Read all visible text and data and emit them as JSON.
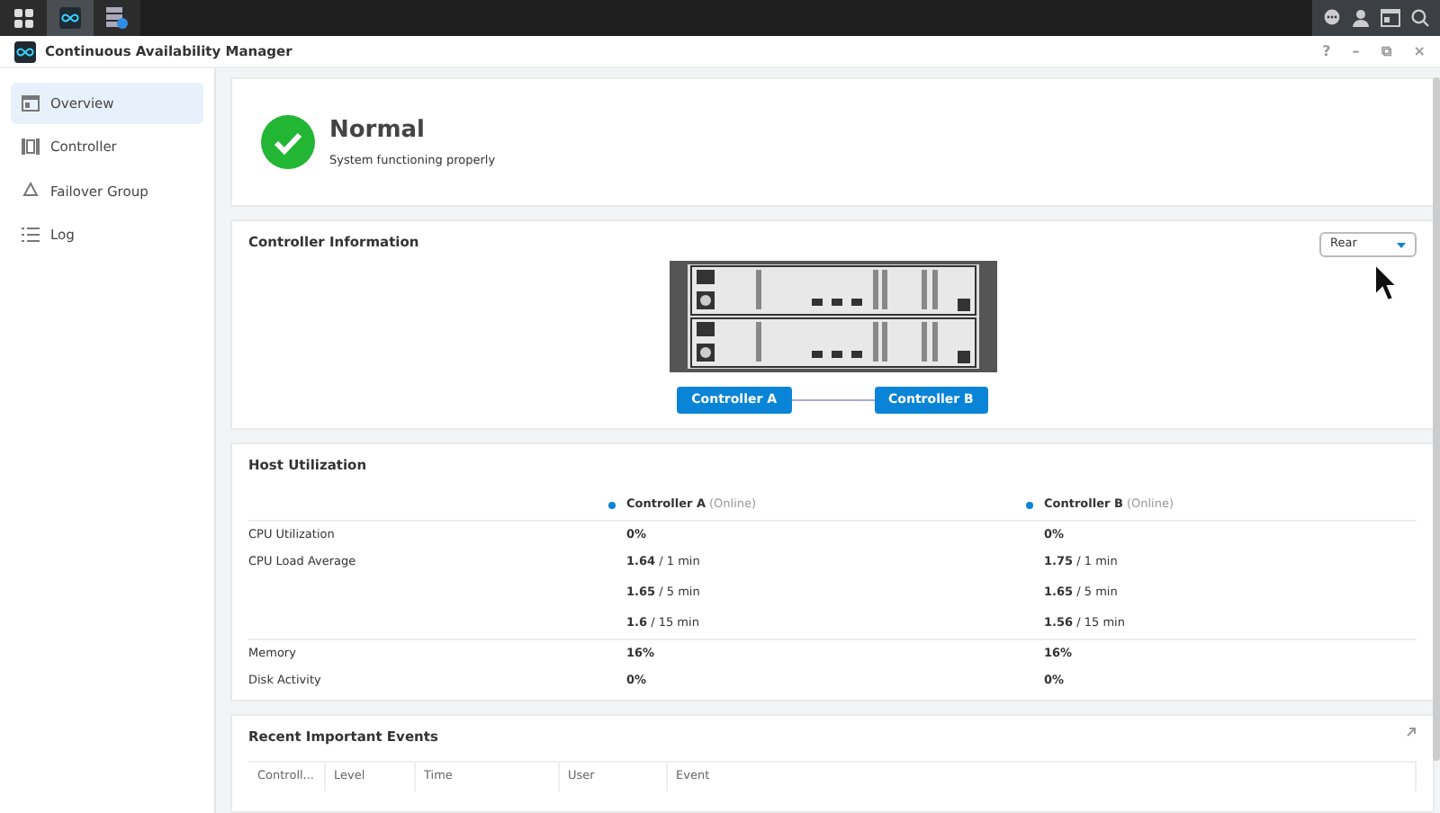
{
  "taskbar": {
    "apps": [
      {
        "selected": false
      },
      {
        "selected": true
      },
      {
        "selected": false
      }
    ]
  },
  "window": {
    "title": "Continuous Availability Manager",
    "controls": [
      "?",
      "–",
      "⧉",
      "×"
    ]
  },
  "sidebar": {
    "items": [
      {
        "label": "Overview",
        "selected": true
      },
      {
        "label": "Controller",
        "selected": false
      },
      {
        "label": "Failover Group",
        "selected": false
      },
      {
        "label": "Log",
        "selected": false
      }
    ]
  },
  "status": {
    "title": "Normal",
    "subtitle": "System functioning properly"
  },
  "controller_information": {
    "title": "Controller Information",
    "view_select": "Rear",
    "controllers": [
      "Controller A",
      "Controller B"
    ]
  },
  "host_utilization": {
    "title": "Host Utilization",
    "controllers": [
      {
        "name": "Controller A",
        "status": "(Online)",
        "color": "#0a84d6"
      },
      {
        "name": "Controller B",
        "status": "(Online)",
        "color": "#0a84d6"
      }
    ],
    "rows": [
      {
        "label": "CPU Utilization",
        "values": [
          [
            "**0%**"
          ],
          [
            "**0%**"
          ]
        ]
      },
      {
        "label": "CPU Load Average",
        "values": [
          [
            "**1.64** / 1 min",
            "**1.65** / 5 min",
            "**1.6** / 15 min"
          ],
          [
            "**1.75** / 1 min",
            "**1.65** / 5 min",
            "**1.56** / 15 min"
          ]
        ]
      },
      {
        "label": "Memory",
        "values": [
          [
            "**16%**"
          ],
          [
            "**16%**"
          ]
        ]
      },
      {
        "label": "Disk Activity",
        "values": [
          [
            "**0%**"
          ],
          [
            "**0%**"
          ]
        ]
      }
    ]
  },
  "recent_events": {
    "title": "Recent Important Events",
    "columns": [
      "Controll...",
      "Level",
      "Time",
      "User",
      "Event"
    ]
  }
}
